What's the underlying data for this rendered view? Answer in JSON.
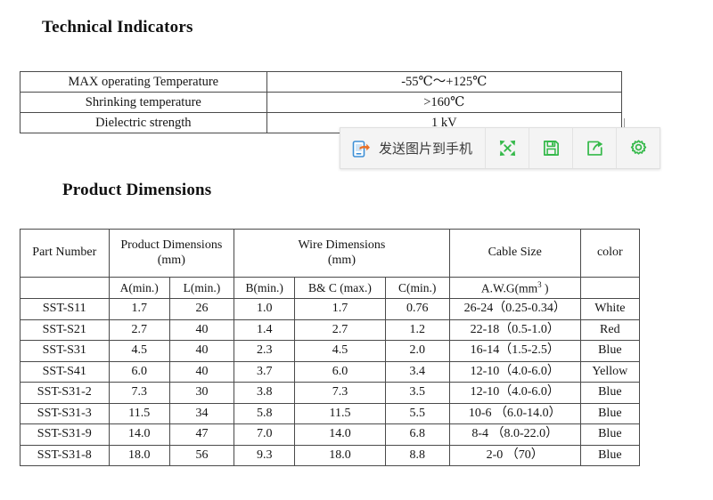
{
  "headings": {
    "technical": "Technical Indicators",
    "dimensions": "Product Dimensions"
  },
  "technical_table": {
    "rows": [
      {
        "label": "MAX operating Temperature",
        "value": "-55℃～+125℃"
      },
      {
        "label": "Shrinking temperature",
        "value": ">160℃"
      },
      {
        "label": "Dielectric strength",
        "value": "1 kV"
      }
    ]
  },
  "dimensions_table": {
    "group_headers": {
      "part_number": "Part Number",
      "product_dimensions_l1": "Product Dimensions",
      "product_dimensions_l2": "(mm)",
      "wire_dimensions_l1": "Wire Dimensions",
      "wire_dimensions_l2": "(mm)",
      "cable_size": "Cable Size",
      "color": "color"
    },
    "sub_headers": {
      "part_number": "",
      "a_min": "A(min.)",
      "l_min": "L(min.)",
      "b_min": "B(min.)",
      "bc_max": "B& C (max.)",
      "c_min": "C(min.)",
      "awg": "A.W.G(mm",
      "awg_sup": "3",
      "awg_tail": " )",
      "color": ""
    },
    "rows": [
      {
        "part": "SST-S11",
        "a": "1.7",
        "l": "26",
        "b": "1.0",
        "bc": "1.7",
        "c": "0.76",
        "awg": "26-24（0.25-0.34）",
        "color": "White"
      },
      {
        "part": "SST-S21",
        "a": "2.7",
        "l": "40",
        "b": "1.4",
        "bc": "2.7",
        "c": "1.2",
        "awg": "22-18（0.5-1.0）",
        "color": "Red"
      },
      {
        "part": "SST-S31",
        "a": "4.5",
        "l": "40",
        "b": "2.3",
        "bc": "4.5",
        "c": "2.0",
        "awg": "16-14（1.5-2.5）",
        "color": "Blue"
      },
      {
        "part": "SST-S41",
        "a": "6.0",
        "l": "40",
        "b": "3.7",
        "bc": "6.0",
        "c": "3.4",
        "awg": "12-10（4.0-6.0）",
        "color": "Yellow"
      },
      {
        "part": "SST-S31-2",
        "a": "7.3",
        "l": "30",
        "b": "3.8",
        "bc": "7.3",
        "c": "3.5",
        "awg": "12-10（4.0-6.0）",
        "color": "Blue"
      },
      {
        "part": "SST-S31-3",
        "a": "11.5",
        "l": "34",
        "b": "5.8",
        "bc": "11.5",
        "c": "5.5",
        "awg": "10-6  （6.0-14.0）",
        "color": "Blue"
      },
      {
        "part": "SST-S31-9",
        "a": "14.0",
        "l": "47",
        "b": "7.0",
        "bc": "14.0",
        "c": "6.8",
        "awg": "8-4  （8.0-22.0）",
        "color": "Blue"
      },
      {
        "part": "SST-S31-8",
        "a": "18.0",
        "l": "56",
        "b": "9.3",
        "bc": "18.0",
        "c": "8.8",
        "awg": "2-0 （70）",
        "color": "Blue"
      }
    ]
  },
  "toolbar": {
    "send_label": "发送图片到手机",
    "icons": {
      "send_to_phone": "phone-with-arrow-icon",
      "fullscreen": "expand-arrows-icon",
      "save": "floppy-disk-icon",
      "share": "share-export-icon",
      "settings": "gear-icon"
    },
    "colors": {
      "icon_green": "#35b94a",
      "phone_blue": "#3d8fd6",
      "arrow_orange": "#e8712a",
      "background": "#f2f2f2"
    }
  }
}
